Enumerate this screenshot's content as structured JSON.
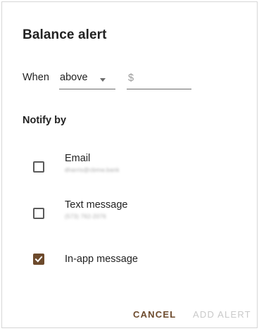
{
  "dialog": {
    "title": "Balance alert",
    "condition": {
      "label": "When",
      "selected": "above",
      "amount_prefix": "$",
      "amount_value": ""
    },
    "notify_heading": "Notify by",
    "options": [
      {
        "label": "Email",
        "detail": "dharris@cbmw.bank",
        "checked": false
      },
      {
        "label": "Text message",
        "detail": "(573) 762-2076",
        "checked": false
      },
      {
        "label": "In-app message",
        "detail": "",
        "checked": true
      }
    ],
    "buttons": {
      "cancel": "CANCEL",
      "add": "ADD ALERT"
    }
  },
  "colors": {
    "accent": "#6d4a2c",
    "disabled": "#c9c9c9",
    "text": "#222222"
  }
}
